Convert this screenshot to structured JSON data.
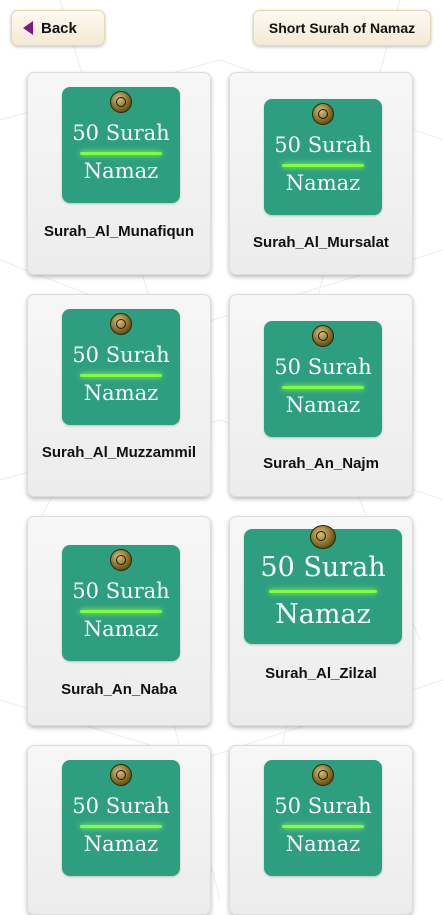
{
  "header": {
    "back_label": "Back",
    "title": "Short Surah of Namaz"
  },
  "thumbnail": {
    "line1": "50 Surah",
    "line2": "Namaz"
  },
  "colors": {
    "thumb_bg": "#2d9f80",
    "glow_line": "#7dff3a",
    "back_arrow": "#7d1a7d"
  },
  "items": [
    {
      "name": "Surah_Al_Munafiqun"
    },
    {
      "name": "Surah_Al_Mursalat"
    },
    {
      "name": "Surah_Al_Muzzammil"
    },
    {
      "name": "Surah_An_Najm"
    },
    {
      "name": "Surah_An_Naba"
    },
    {
      "name": "Surah_Al_Zilzal"
    },
    {
      "name": ""
    },
    {
      "name": ""
    }
  ]
}
